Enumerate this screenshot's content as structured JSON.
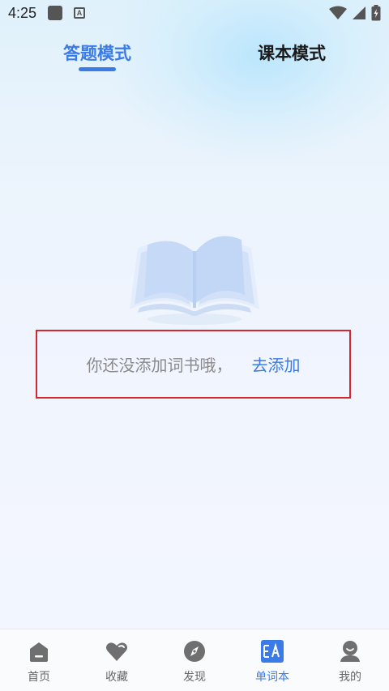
{
  "status_bar": {
    "time": "4:25"
  },
  "tabs": [
    {
      "label": "答题模式",
      "active": true
    },
    {
      "label": "课本模式",
      "active": false
    }
  ],
  "empty_state": {
    "message": "你还没添加词书哦，",
    "action_label": "去添加"
  },
  "bottom_nav": [
    {
      "label": "首页",
      "icon": "home-icon",
      "active": false
    },
    {
      "label": "收藏",
      "icon": "heart-icon",
      "active": false
    },
    {
      "label": "发现",
      "icon": "compass-icon",
      "active": false
    },
    {
      "label": "单词本",
      "icon": "vocabulary-icon",
      "active": true
    },
    {
      "label": "我的",
      "icon": "profile-icon",
      "active": false
    }
  ],
  "colors": {
    "accent": "#3b7be7",
    "inactive_icon": "#6f6f6f",
    "highlight_border": "#d6262f"
  }
}
